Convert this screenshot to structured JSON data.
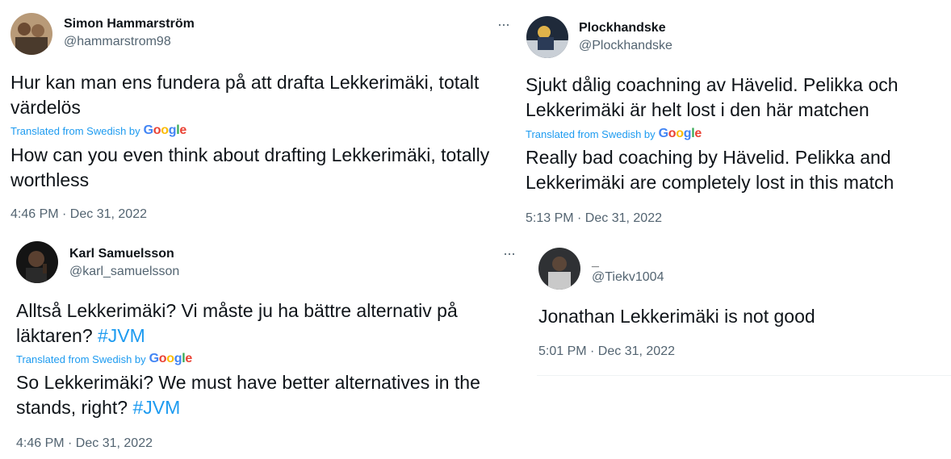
{
  "tweets": [
    {
      "name": "Simon Hammarström",
      "handle": "@hammarstrom98",
      "text": "Hur kan man ens fundera på att drafta Lekkerimäki, totalt värdelös",
      "translated_label": "Translated from Swedish by",
      "translation": "How can you even think about drafting Lekkerimäki, totally worthless",
      "time": "4:46 PM · Dec 31, 2022",
      "more": "···"
    },
    {
      "name": "Plockhandske",
      "handle": "@Plockhandske",
      "text": "Sjukt dålig coachning av Hävelid. Pelikka och Lekkerimäki är helt lost i den här matchen",
      "translated_label": "Translated from Swedish by",
      "translation": "Really bad coaching by Hävelid. Pelikka and Lekkerimäki are completely lost in this match",
      "time": "5:13 PM · Dec 31, 2022"
    },
    {
      "name": "Karl Samuelsson",
      "handle": "@karl_samuelsson",
      "text_before": "Alltså Lekkerimäki? Vi måste ju ha bättre alternativ på läktaren?",
      "hashtag": "#JVM",
      "translated_label": "Translated from Swedish by",
      "translation_before": "So Lekkerimäki? We must have better alternatives in the stands, right?",
      "translation_hashtag": "#JVM",
      "time": "4:46 PM · Dec 31, 2022",
      "more": "···"
    },
    {
      "name": "_",
      "handle": "@Tiekv1004",
      "text": "Jonathan Lekkerimäki is not good",
      "time": "5:01 PM · Dec 31, 2022"
    }
  ],
  "google_logo": [
    "G",
    "o",
    "o",
    "g",
    "l",
    "e"
  ],
  "colors": {
    "link": "#1d9bf0",
    "secondary": "#536471",
    "primary": "#0f1419"
  }
}
